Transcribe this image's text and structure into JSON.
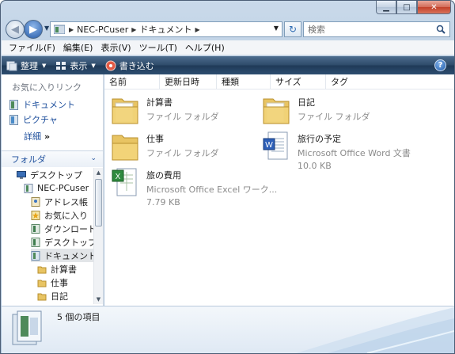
{
  "window": {
    "minimize_label": "▁",
    "maximize_label": "□",
    "close_label": "✕"
  },
  "address": {
    "segments": [
      "NEC-PCuser",
      "ドキュメント"
    ],
    "search_placeholder": "検索"
  },
  "menu": [
    "ファイル(F)",
    "編集(E)",
    "表示(V)",
    "ツール(T)",
    "ヘルプ(H)"
  ],
  "toolbar": {
    "organize": "整理",
    "view": "表示",
    "burn": "書き込む",
    "help": "?"
  },
  "navpane": {
    "favorites_title": "お気に入りリンク",
    "favorites": [
      "ドキュメント",
      "ピクチャ"
    ],
    "more": "詳細",
    "more_arrow": "»",
    "folders_title": "フォルダ",
    "tree": [
      {
        "label": "デスクトップ",
        "icon": "desktop-icon"
      },
      {
        "label": "NEC-PCuser",
        "icon": "user-folder-icon"
      },
      {
        "label": "アドレス帳",
        "icon": "contacts-icon"
      },
      {
        "label": "お気に入り",
        "icon": "favorites-icon"
      },
      {
        "label": "ダウンロード",
        "icon": "downloads-icon"
      },
      {
        "label": "デスクトップ",
        "icon": "desktop-folder-icon"
      },
      {
        "label": "ドキュメント",
        "icon": "documents-icon"
      },
      {
        "label": "計算書",
        "icon": "folder-icon"
      },
      {
        "label": "仕事",
        "icon": "folder-icon"
      },
      {
        "label": "日記",
        "icon": "folder-icon"
      }
    ]
  },
  "columns": [
    "名前",
    "更新日時",
    "種類",
    "サイズ",
    "タグ"
  ],
  "files": [
    {
      "name": "計算書",
      "type": "ファイル フォルダ",
      "size": "",
      "icon": "folder-icon"
    },
    {
      "name": "日記",
      "type": "ファイル フォルダ",
      "size": "",
      "icon": "folder-icon"
    },
    {
      "name": "仕事",
      "type": "ファイル フォルダ",
      "size": "",
      "icon": "folder-icon"
    },
    {
      "name": "旅行の予定",
      "type": "Microsoft Office Word 文書",
      "size": "10.0 KB",
      "icon": "word-document-icon"
    },
    {
      "name": "旅の費用",
      "type": "Microsoft Office Excel ワーク...",
      "size": "7.79 KB",
      "icon": "excel-workbook-icon"
    }
  ],
  "details": {
    "count": "5 個の項目"
  },
  "colors": {
    "link": "#1e4f9c",
    "toolbar": "#2f4c6b",
    "folder": "#e8c463"
  }
}
